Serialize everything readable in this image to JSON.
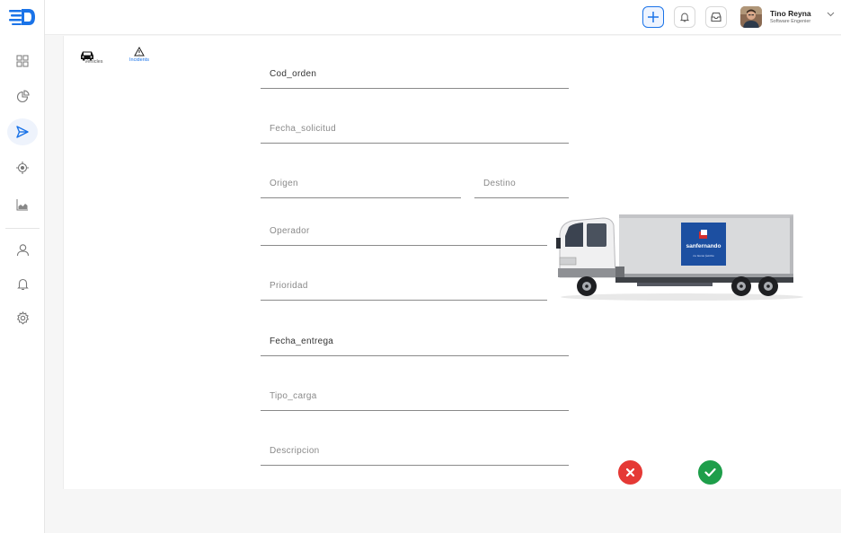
{
  "header": {
    "user": {
      "name": "Tino Reyna",
      "role": "Software Engenier"
    },
    "buttons": [
      "plus-icon",
      "bell-icon",
      "inbox-icon"
    ]
  },
  "sidebar": {
    "icons": [
      "dashboard-icon",
      "pie-chart-icon",
      "send-icon",
      "location-target-icon",
      "area-chart-icon",
      "user-icon",
      "bell-icon",
      "settings-icon"
    ],
    "active": "send-icon"
  },
  "tabs": [
    {
      "label": "Vehicles",
      "icon": "car-icon",
      "active": false
    },
    {
      "label": "Incidents",
      "icon": "warning-icon",
      "active": true
    }
  ],
  "form": {
    "cod_orden": "Cod_orden",
    "fecha_solicitud": "Fecha_solicitud",
    "origen": "Origen",
    "destino": "Destino",
    "operador": "Operador",
    "prioridad": "Prioridad",
    "fecha_entrega": "Fecha_entrega",
    "tipo_carga": "Tipo_carga",
    "descripcion": "Descripcion"
  },
  "truck": {
    "brand": "sanfernando",
    "slogan": "La buena familia"
  },
  "colors": {
    "accent": "#1a73e8",
    "cancel": "#e53935",
    "confirm": "#1e9e4a"
  }
}
